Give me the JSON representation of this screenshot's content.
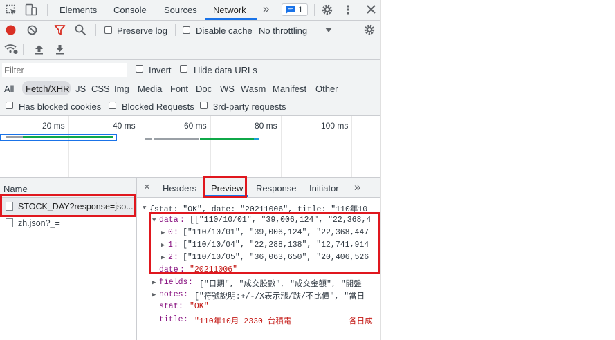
{
  "main_tabs": [
    "Elements",
    "Console",
    "Sources",
    "Network"
  ],
  "active_tab": "Network",
  "more_tabs": "»",
  "issues_count": "1",
  "toolbar": {
    "preserve_log": "Preserve log",
    "disable_cache": "Disable cache",
    "throttling": "No throttling"
  },
  "filter": {
    "placeholder": "Filter",
    "invert": "Invert",
    "hide_data_urls": "Hide data URLs"
  },
  "type_filters": [
    "All",
    "Fetch/XHR",
    "JS",
    "CSS",
    "Img",
    "Media",
    "Font",
    "Doc",
    "WS",
    "Wasm",
    "Manifest",
    "Other"
  ],
  "active_type": "Fetch/XHR",
  "blocked": {
    "has_blocked_cookies": "Has blocked cookies",
    "blocked_requests": "Blocked Requests",
    "third_party": "3rd-party requests"
  },
  "timeline_ticks": [
    "20 ms",
    "40 ms",
    "60 ms",
    "80 ms",
    "100 ms"
  ],
  "requests": {
    "header": "Name",
    "items": [
      "STOCK_DAY?response=jso...",
      "zh.json?_="
    ]
  },
  "detail_tabs": [
    "Headers",
    "Preview",
    "Response",
    "Initiator"
  ],
  "active_detail_tab": "Preview",
  "close_symbol": "×",
  "preview": {
    "root": "{stat: \"OK\", date: \"20211006\", title: \"110年10",
    "data_key": "data",
    "data_summary": "[[\"110/10/01\", \"39,006,124\", \"22,368,4",
    "rows": [
      {
        "index": "0",
        "value": "[\"110/10/01\", \"39,006,124\", \"22,368,447"
      },
      {
        "index": "1",
        "value": "[\"110/10/04\", \"22,288,138\", \"12,741,914"
      },
      {
        "index": "2",
        "value": "[\"110/10/05\", \"36,063,650\", \"20,406,526"
      }
    ],
    "date_key": "date",
    "date_value": "\"20211006\"",
    "fields_key": "fields",
    "fields_value": "[\"日期\", \"成交股數\", \"成交金額\", \"開盤",
    "notes_key": "notes",
    "notes_value": "[\"符號說明:+/-/X表示漲/跌/不比價\", \"當日",
    "stat_key": "stat",
    "stat_value": "\"OK\"",
    "title_key": "title",
    "title_value": "\"110年10月 2330 台積電            各日成"
  },
  "colors": {
    "accent": "#1a73e8",
    "highlight": "#e0171e",
    "key": "#881280",
    "string": "#c41a16"
  }
}
